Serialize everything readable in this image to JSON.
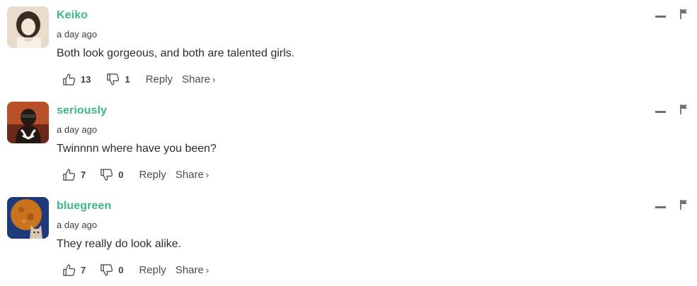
{
  "comments": [
    {
      "username": "Keiko",
      "timestamp": "a day ago",
      "text": "Both look gorgeous, and both are talented girls.",
      "upvotes": "13",
      "downvotes": "1",
      "reply_label": "Reply",
      "share_label": "Share",
      "share_chevron": "›",
      "avatar_colors": [
        "#e9dccc",
        "#3a2a22",
        "#f3e6d8"
      ]
    },
    {
      "username": "seriously",
      "timestamp": "a day ago",
      "text": "Twinnnn where have you been?",
      "upvotes": "7",
      "downvotes": "0",
      "reply_label": "Reply",
      "share_label": "Share",
      "share_chevron": "›",
      "avatar_colors": [
        "#b8502a",
        "#241815",
        "#f2f0ea"
      ]
    },
    {
      "username": "bluegreen",
      "timestamp": "a day ago",
      "text": "They really do look alike.",
      "upvotes": "7",
      "downvotes": "0",
      "reply_label": "Reply",
      "share_label": "Share",
      "share_chevron": "›",
      "avatar_colors": [
        "#1f3a7a",
        "#c9731f",
        "#d9c6b4"
      ]
    }
  ],
  "icons": {
    "upvote": "thumbs-up-icon",
    "downvote": "thumbs-down-icon",
    "collapse": "minus-icon",
    "flag": "flag-icon"
  },
  "theme": {
    "username_color": "#3cb883",
    "text_color": "#2a2e2e",
    "meta_color": "#4a4f55"
  }
}
